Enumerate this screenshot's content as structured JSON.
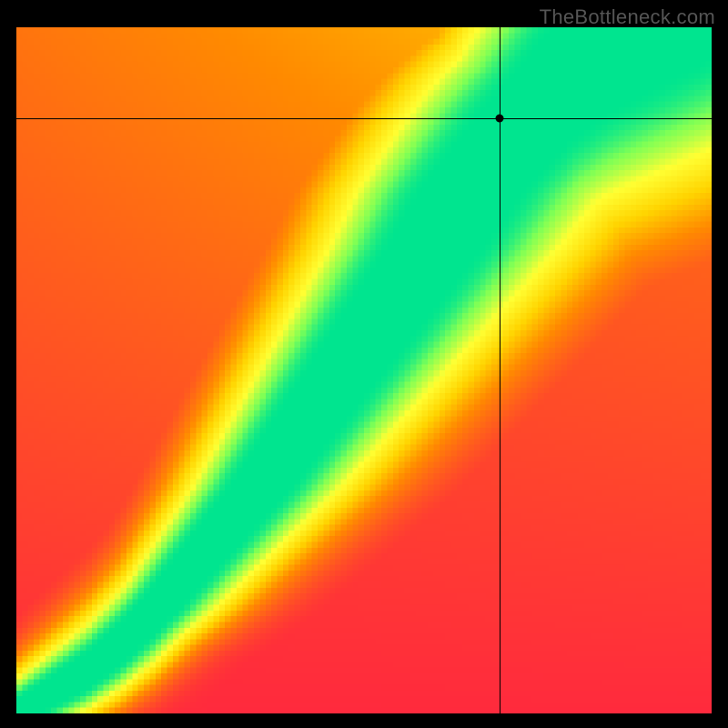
{
  "watermark": "TheBottleneck.com",
  "chart_data": {
    "type": "heatmap",
    "title": "",
    "xlabel": "",
    "ylabel": "",
    "xlim": [
      0,
      1
    ],
    "ylim": [
      0,
      1
    ],
    "grid": false,
    "legend": false,
    "marker": {
      "x": 0.695,
      "y": 0.867
    },
    "crosshair": {
      "x": 0.695,
      "y": 0.867
    },
    "colorscale": [
      {
        "stop": 0.0,
        "color": "#ff2a3d"
      },
      {
        "stop": 0.35,
        "color": "#ff8a00"
      },
      {
        "stop": 0.55,
        "color": "#ffd400"
      },
      {
        "stop": 0.75,
        "color": "#ffff33"
      },
      {
        "stop": 0.9,
        "color": "#7fff55"
      },
      {
        "stop": 1.0,
        "color": "#00e58f"
      }
    ],
    "pixelation": 120,
    "field_description": "Smooth 2D match field; green ridge along a near-diagonal curve from bottom-left to top-right, flanked by yellow then orange then red with distance.",
    "ridge_points": [
      {
        "x": 0.0,
        "y": 0.0
      },
      {
        "x": 0.05,
        "y": 0.03
      },
      {
        "x": 0.1,
        "y": 0.06
      },
      {
        "x": 0.15,
        "y": 0.1
      },
      {
        "x": 0.2,
        "y": 0.15
      },
      {
        "x": 0.25,
        "y": 0.21
      },
      {
        "x": 0.3,
        "y": 0.27
      },
      {
        "x": 0.35,
        "y": 0.33
      },
      {
        "x": 0.4,
        "y": 0.4
      },
      {
        "x": 0.45,
        "y": 0.47
      },
      {
        "x": 0.5,
        "y": 0.54
      },
      {
        "x": 0.55,
        "y": 0.61
      },
      {
        "x": 0.6,
        "y": 0.68
      },
      {
        "x": 0.65,
        "y": 0.76
      },
      {
        "x": 0.7,
        "y": 0.82
      },
      {
        "x": 0.75,
        "y": 0.88
      },
      {
        "x": 0.8,
        "y": 0.93
      },
      {
        "x": 0.85,
        "y": 0.97
      },
      {
        "x": 0.9,
        "y": 1.0
      }
    ],
    "ridge_width": 0.055,
    "background_field": {
      "type": "corner-gradient",
      "bottom_left": 0.0,
      "top_right": 0.55,
      "top_left": 0.27,
      "bottom_right": 0.0
    }
  }
}
